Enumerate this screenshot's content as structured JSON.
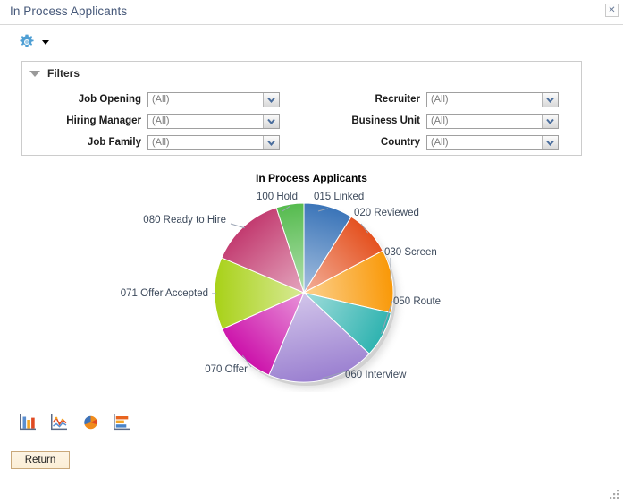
{
  "window": {
    "title": "In Process Applicants",
    "close_label": "✕"
  },
  "toolbar": {
    "gear_icon": "gear-icon",
    "caret_icon": "chevron-down-icon"
  },
  "filters": {
    "legend": "Filters",
    "collapse_icon": "triangle-down-icon",
    "fields": [
      {
        "label": "Job Opening",
        "value": "(All)",
        "name": "job-opening"
      },
      {
        "label": "Recruiter",
        "value": "(All)",
        "name": "recruiter"
      },
      {
        "label": "Hiring Manager",
        "value": "(All)",
        "name": "hiring-manager"
      },
      {
        "label": "Business Unit",
        "value": "(All)",
        "name": "business-unit"
      },
      {
        "label": "Job Family",
        "value": "(All)",
        "name": "job-family"
      },
      {
        "label": "Country",
        "value": "(All)",
        "name": "country"
      }
    ]
  },
  "chart_data": {
    "type": "pie",
    "title": "In Process Applicants",
    "xlabel": "",
    "ylabel": "",
    "legend_position": "none",
    "grid": false,
    "categories": [
      "015 Linked",
      "020 Reviewed",
      "030 Screen",
      "050 Route",
      "060 Interview",
      "070 Offer",
      "071 Offer Accepted",
      "080 Ready to Hire",
      "100 Hold"
    ],
    "values": [
      9,
      8,
      11,
      8,
      19,
      12,
      13,
      14,
      5
    ],
    "colors": [
      "#3a74b8",
      "#e4501e",
      "#f99806",
      "#2fb3b0",
      "#9a7fd0",
      "#cc11aa",
      "#a8d117",
      "#c23a6f",
      "#55bb4e"
    ],
    "slices": [
      {
        "label": "015 Linked",
        "value": 9,
        "start_angle": 0,
        "end_angle": 32,
        "color": "#3a74b8"
      },
      {
        "label": "020 Reviewed",
        "value": 8,
        "start_angle": 32,
        "end_angle": 62,
        "color": "#e4501e"
      },
      {
        "label": "030 Screen",
        "value": 11,
        "start_angle": 62,
        "end_angle": 103,
        "color": "#f99806"
      },
      {
        "label": "050 Route",
        "value": 8,
        "start_angle": 103,
        "end_angle": 133,
        "color": "#2fb3b0"
      },
      {
        "label": "060 Interview",
        "value": 19,
        "start_angle": 133,
        "end_angle": 203,
        "color": "#9a7fd0"
      },
      {
        "label": "070 Offer",
        "value": 12,
        "start_angle": 203,
        "end_angle": 246,
        "color": "#cc11aa"
      },
      {
        "label": "071 Offer Accepted",
        "value": 13,
        "start_angle": 246,
        "end_angle": 293,
        "color": "#a8d117"
      },
      {
        "label": "080 Ready to Hire",
        "value": 14,
        "start_angle": 293,
        "end_angle": 342,
        "color": "#c23a6f"
      },
      {
        "label": "100 Hold",
        "value": 5,
        "start_angle": 342,
        "end_angle": 360,
        "color": "#55bb4e"
      }
    ]
  },
  "chart_types": [
    {
      "name": "bar-chart-icon",
      "label": "Bar Chart"
    },
    {
      "name": "line-chart-icon",
      "label": "Line Chart"
    },
    {
      "name": "pie-chart-icon",
      "label": "Pie Chart"
    },
    {
      "name": "horizontal-bar-chart-icon",
      "label": "Horizontal Bar Chart"
    }
  ],
  "actions": {
    "return_label": "Return"
  }
}
